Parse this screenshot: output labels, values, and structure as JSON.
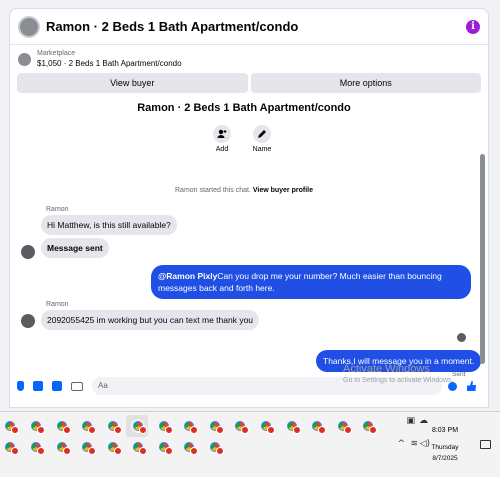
{
  "header": {
    "title": "Ramon · 2 Beds 1 Bath Apartment/condo",
    "info_icon": "info-icon",
    "accent": "#9b1fd8"
  },
  "listing": {
    "label": "Marketplace",
    "value": "$1,050 · 2 Beds 1 Bath Apartment/condo"
  },
  "actions": {
    "view_buyer": "View buyer",
    "more_options": "More options"
  },
  "thread": {
    "title": "Ramon · 2 Beds 1 Bath Apartment/condo",
    "quick_actions": [
      {
        "label": "Add",
        "icon": "add-person-icon"
      },
      {
        "label": "Name",
        "icon": "pencil-icon"
      }
    ],
    "started_prefix": "Ramon started this chat.",
    "started_link": "View buyer profile",
    "messages": [
      {
        "from": "Ramon",
        "sender_name": "Ramon",
        "text": "Hi Matthew, is this still available?"
      },
      {
        "from": "Ramon",
        "text": "Message sent"
      },
      {
        "from": "me",
        "mention": "@Ramon Pixly",
        "text": "Can you drop me your number? Much easier than bouncing messages back and forth here."
      },
      {
        "from": "Ramon",
        "sender_name": "Ramon",
        "text": "2092055425 im working but you can text me thank you"
      },
      {
        "from": "me",
        "text": "Thanks,I will message you in a moment.",
        "status": "Sent"
      }
    ],
    "outgoing_color": "#1f4fe4"
  },
  "composer": {
    "placeholder": "Aa"
  },
  "watermark": {
    "title": "Activate Windows",
    "subtitle": "Go to Settings to activate Windows."
  },
  "taskbar": {
    "time": "8:03 PM",
    "day": "Thursday",
    "date": "8/7/2025"
  }
}
